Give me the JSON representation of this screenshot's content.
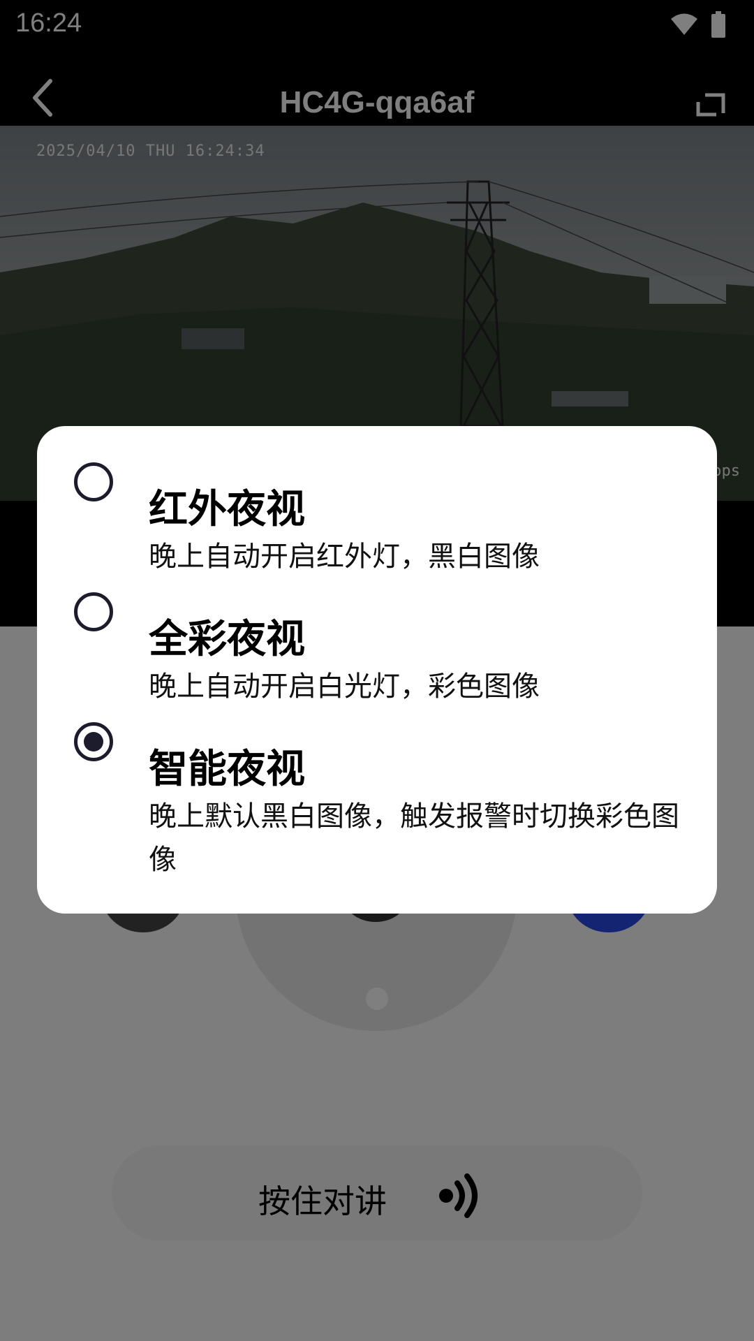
{
  "status_bar": {
    "time": "16:24",
    "icons": [
      "wifi-icon",
      "battery-icon"
    ]
  },
  "header": {
    "title": "HC4G-qqa6af",
    "back_icon": "chevron-left-icon",
    "fullscreen_icon": "fullscreen-icon"
  },
  "video": {
    "timestamp": "2025/04/10 THU 16:24:34",
    "bitrate_fragment": "ops"
  },
  "talk": {
    "label": "按住对讲",
    "icon": "speaker-wave-icon"
  },
  "dialog": {
    "options": [
      {
        "title": "红外夜视",
        "description": "晚上自动开启红外灯，黑白图像",
        "selected": false
      },
      {
        "title": "全彩夜视",
        "description": "晚上自动开启白光灯，彩色图像",
        "selected": false
      },
      {
        "title": "智能夜视",
        "description": "晚上默认黑白图像，触发报警时切换彩色图像",
        "selected": true
      }
    ]
  },
  "colors": {
    "radio": "#1c1c2c",
    "accent_button": "#2a46e6",
    "overlay": "rgba(0,0,0,0.5)"
  }
}
